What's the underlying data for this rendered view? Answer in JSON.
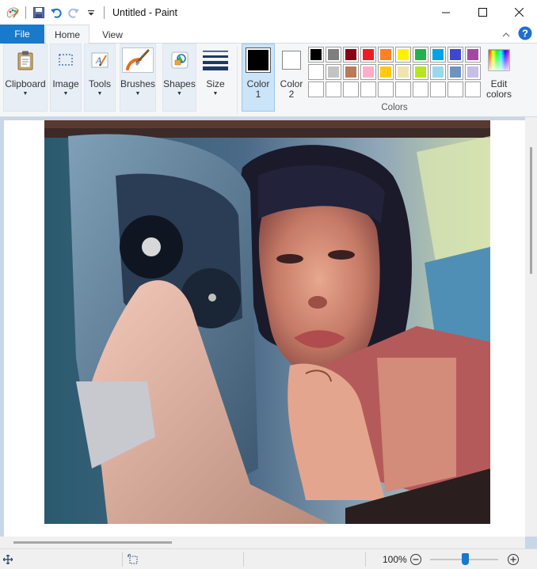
{
  "window": {
    "title": "Untitled - Paint"
  },
  "tabs": {
    "file": "File",
    "home": "Home",
    "view": "View"
  },
  "ribbon": {
    "clipboard": "Clipboard",
    "image": "Image",
    "tools": "Tools",
    "brushes": "Brushes",
    "shapes": "Shapes",
    "size": "Size",
    "color1_line1": "Color",
    "color1_line2": "1",
    "color2_line1": "Color",
    "color2_line2": "2",
    "colors_group": "Colors",
    "edit_colors_line1": "Edit",
    "edit_colors_line2": "colors"
  },
  "palette": {
    "row1": [
      "#000000",
      "#7f7f7f",
      "#880015",
      "#ed1c24",
      "#ff7f27",
      "#fff200",
      "#22b14c",
      "#00a2e8",
      "#3f48cc",
      "#a349a4"
    ],
    "row2": [
      "#ffffff",
      "#c3c3c3",
      "#b97a57",
      "#ffaec9",
      "#ffc90e",
      "#efe4b0",
      "#b5e61d",
      "#99d9ea",
      "#7092be",
      "#c8bfe7"
    ],
    "row3": [
      "",
      "",
      "",
      "",
      "",
      "",
      "",
      "",
      "",
      ""
    ]
  },
  "colors": {
    "color1": "#000000",
    "color2": "#ffffff",
    "accent": "#1979ca"
  },
  "canvas": {
    "description_icon": "painted-selfie-image"
  },
  "statusbar": {
    "zoom": "100%",
    "zoom_level": 1.0
  }
}
